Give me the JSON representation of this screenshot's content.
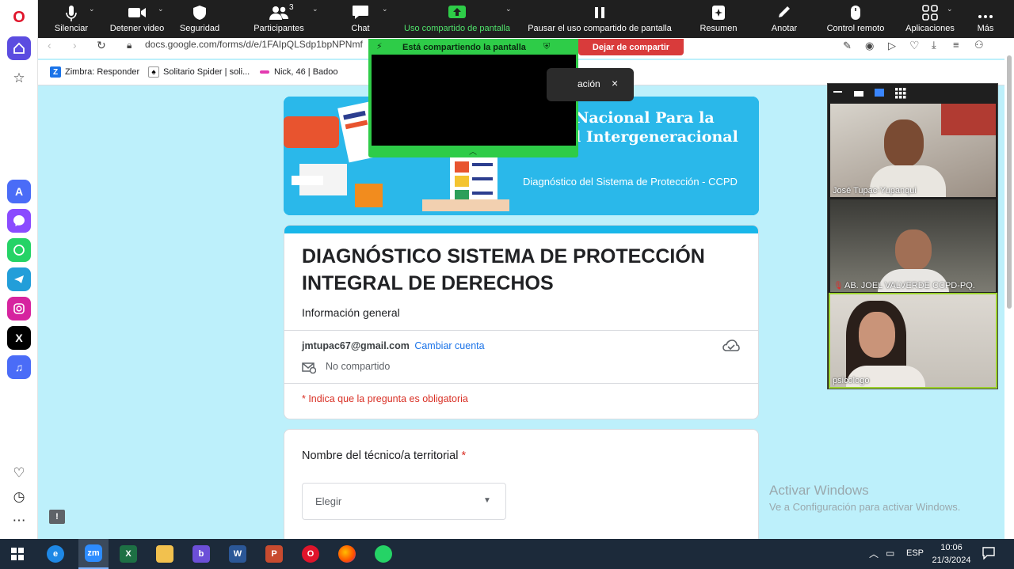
{
  "zoom": {
    "toolbar": [
      {
        "label": "Silenciar",
        "icon": "microphone-icon"
      },
      {
        "label": "Detener video",
        "icon": "video-camera-icon"
      },
      {
        "label": "Seguridad",
        "icon": "shield-icon"
      },
      {
        "label": "Participantes",
        "icon": "participants-icon",
        "count": "3"
      },
      {
        "label": "Chat",
        "icon": "chat-icon"
      },
      {
        "label": "Uso compartido de pantalla",
        "icon": "share-screen-icon"
      },
      {
        "label": "Pausar el uso compartido de pantalla",
        "icon": "pause-icon"
      },
      {
        "label": "Resumen",
        "icon": "summary-icon"
      },
      {
        "label": "Anotar",
        "icon": "pencil-icon"
      },
      {
        "label": "Control remoto",
        "icon": "mouse-icon"
      },
      {
        "label": "Aplicaciones",
        "icon": "apps-icon"
      },
      {
        "label": "Más",
        "icon": "more-icon"
      }
    ],
    "sharing_label": "Está compartiendo la pantalla",
    "stop_share": "Dejar de compartir",
    "toast_text": "ación",
    "toast_close": "×",
    "accent": "#2ecc48"
  },
  "browser": {
    "url": "docs.google.com/forms/d/e/1FAIpQLSdp1bpNPNmf",
    "bookmarks": [
      {
        "label": "Zimbra: Responder",
        "icon": "zimbra-icon",
        "badge": "Z"
      },
      {
        "label": "Solitario Spider | soli...",
        "icon": "spider-solitaire-icon",
        "badge": ""
      },
      {
        "label": "Nick, 46 | Badoo",
        "icon": "badoo-icon",
        "badge": ""
      }
    ]
  },
  "form": {
    "banner_title_1": "Nacional Para la",
    "banner_title_2": "l Intergeneracional",
    "banner_subtitle": "Diagnóstico del Sistema de Protección - CCPD",
    "title": "DIAGNÓSTICO SISTEMA DE PROTECCIÓN INTEGRAL DE DERECHOS",
    "description": "Información general",
    "email": "jmtupac67@gmail.com",
    "switch_account": "Cambiar cuenta",
    "not_shared": "No compartido",
    "required_note": "* Indica que la pregunta es obligatoria",
    "question_label": "Nombre del técnico/a territorial",
    "required_mark": "*",
    "select_placeholder": "Elegir",
    "accent": "#18b7ea"
  },
  "participants": [
    {
      "name": "José Tupac-Yupanqui"
    },
    {
      "name": "AB. JOEL VALVERDE CCPD-PQ."
    },
    {
      "name": "psicologo"
    }
  ],
  "windows": {
    "activate_title": "Activar Windows",
    "activate_sub": "Ve a Configuración para activar Windows.",
    "lang": "ESP",
    "time": "10:06",
    "date": "21/3/2024",
    "taskbar_apps": [
      {
        "name": "edge",
        "badge": "e",
        "color": "#1e88e5"
      },
      {
        "name": "zoom",
        "badge": "zm",
        "color": "#2d8cff"
      },
      {
        "name": "excel",
        "badge": "X",
        "color": "#1d7044"
      },
      {
        "name": "file-explorer",
        "badge": "",
        "color": "#f2c14e"
      },
      {
        "name": "bing",
        "badge": "b",
        "color": "#6c4fd8"
      },
      {
        "name": "word",
        "badge": "W",
        "color": "#2b5797"
      },
      {
        "name": "powerpoint",
        "badge": "P",
        "color": "#c84b2f"
      },
      {
        "name": "opera",
        "badge": "O",
        "color": "#e0152b"
      },
      {
        "name": "firefox",
        "badge": "",
        "color": "#ff7b00"
      },
      {
        "name": "whatsapp",
        "badge": "",
        "color": "#25d366"
      }
    ]
  }
}
